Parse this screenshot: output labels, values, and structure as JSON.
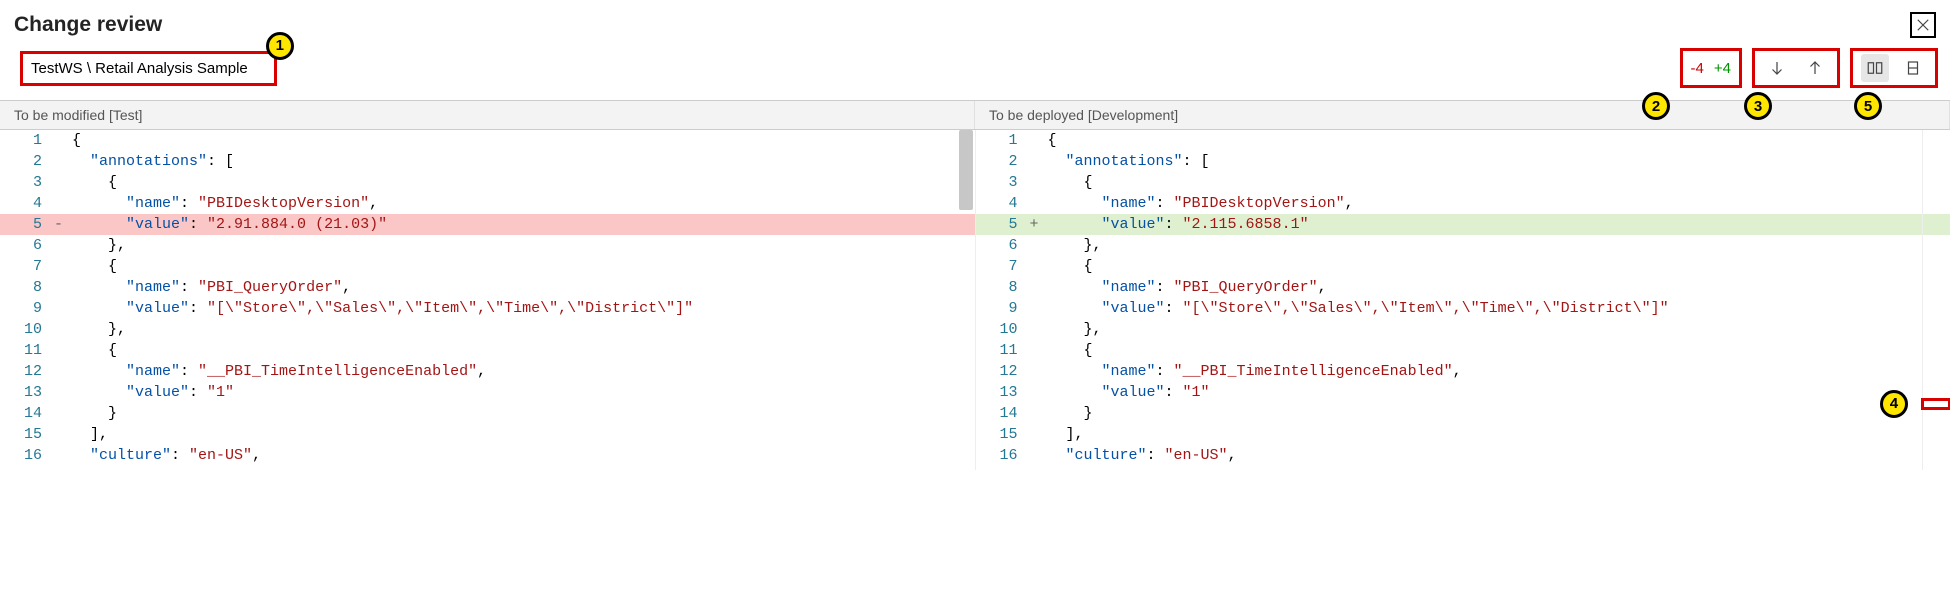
{
  "title": "Change review",
  "breadcrumb": "TestWS \\ Retail Analysis Sample",
  "diffCounts": {
    "removed": "-4",
    "added": "+4"
  },
  "headers": {
    "left": "To be modified [Test]",
    "right": "To be deployed [Development]"
  },
  "callouts": {
    "c1": "1",
    "c2": "2",
    "c3": "3",
    "c4": "4",
    "c5": "5"
  },
  "icons": {
    "close": "close-icon",
    "navDown": "arrow-down-icon",
    "navUp": "arrow-up-icon",
    "sidebyside": "side-by-side-view-icon",
    "inline": "inline-view-icon"
  },
  "code": {
    "left": [
      {
        "n": "1",
        "m": "",
        "tokens": [
          [
            "brace",
            "{"
          ]
        ]
      },
      {
        "n": "2",
        "m": "",
        "tokens": [
          [
            "sp",
            "  "
          ],
          [
            "key",
            "\"annotations\""
          ],
          [
            "punc",
            ": ["
          ]
        ]
      },
      {
        "n": "3",
        "m": "",
        "tokens": [
          [
            "sp",
            "    "
          ],
          [
            "brace",
            "{"
          ]
        ]
      },
      {
        "n": "4",
        "m": "",
        "tokens": [
          [
            "sp",
            "      "
          ],
          [
            "key",
            "\"name\""
          ],
          [
            "punc",
            ": "
          ],
          [
            "str",
            "\"PBIDesktopVersion\""
          ],
          [
            "punc",
            ","
          ]
        ]
      },
      {
        "n": "5",
        "m": "-",
        "hl": "del",
        "tokens": [
          [
            "sp",
            "      "
          ],
          [
            "key",
            "\"value\""
          ],
          [
            "punc",
            ": "
          ],
          [
            "str",
            "\"2.91.884.0 (21.03)\""
          ]
        ]
      },
      {
        "n": "6",
        "m": "",
        "tokens": [
          [
            "sp",
            "    "
          ],
          [
            "brace",
            "},"
          ]
        ]
      },
      {
        "n": "7",
        "m": "",
        "tokens": [
          [
            "sp",
            "    "
          ],
          [
            "brace",
            "{"
          ]
        ]
      },
      {
        "n": "8",
        "m": "",
        "tokens": [
          [
            "sp",
            "      "
          ],
          [
            "key",
            "\"name\""
          ],
          [
            "punc",
            ": "
          ],
          [
            "str",
            "\"PBI_QueryOrder\""
          ],
          [
            "punc",
            ","
          ]
        ]
      },
      {
        "n": "9",
        "m": "",
        "tokens": [
          [
            "sp",
            "      "
          ],
          [
            "key",
            "\"value\""
          ],
          [
            "punc",
            ": "
          ],
          [
            "str",
            "\"[\\\"Store\\\",\\\"Sales\\\",\\\"Item\\\",\\\"Time\\\",\\\"District\\\"]\""
          ]
        ]
      },
      {
        "n": "10",
        "m": "",
        "tokens": [
          [
            "sp",
            "    "
          ],
          [
            "brace",
            "},"
          ]
        ]
      },
      {
        "n": "11",
        "m": "",
        "tokens": [
          [
            "sp",
            "    "
          ],
          [
            "brace",
            "{"
          ]
        ]
      },
      {
        "n": "12",
        "m": "",
        "tokens": [
          [
            "sp",
            "      "
          ],
          [
            "key",
            "\"name\""
          ],
          [
            "punc",
            ": "
          ],
          [
            "str",
            "\"__PBI_TimeIntelligenceEnabled\""
          ],
          [
            "punc",
            ","
          ]
        ]
      },
      {
        "n": "13",
        "m": "",
        "tokens": [
          [
            "sp",
            "      "
          ],
          [
            "key",
            "\"value\""
          ],
          [
            "punc",
            ": "
          ],
          [
            "str",
            "\"1\""
          ]
        ]
      },
      {
        "n": "14",
        "m": "",
        "tokens": [
          [
            "sp",
            "    "
          ],
          [
            "brace",
            "}"
          ]
        ]
      },
      {
        "n": "15",
        "m": "",
        "tokens": [
          [
            "sp",
            "  "
          ],
          [
            "punc",
            "],"
          ]
        ]
      },
      {
        "n": "16",
        "m": "",
        "tokens": [
          [
            "sp",
            "  "
          ],
          [
            "key",
            "\"culture\""
          ],
          [
            "punc",
            ": "
          ],
          [
            "str",
            "\"en-US\""
          ],
          [
            "punc",
            ","
          ]
        ]
      }
    ],
    "right": [
      {
        "n": "1",
        "m": "",
        "tokens": [
          [
            "brace",
            "{"
          ]
        ]
      },
      {
        "n": "2",
        "m": "",
        "tokens": [
          [
            "sp",
            "  "
          ],
          [
            "key",
            "\"annotations\""
          ],
          [
            "punc",
            ": ["
          ]
        ]
      },
      {
        "n": "3",
        "m": "",
        "tokens": [
          [
            "sp",
            "    "
          ],
          [
            "brace",
            "{"
          ]
        ]
      },
      {
        "n": "4",
        "m": "",
        "tokens": [
          [
            "sp",
            "      "
          ],
          [
            "key",
            "\"name\""
          ],
          [
            "punc",
            ": "
          ],
          [
            "str",
            "\"PBIDesktopVersion\""
          ],
          [
            "punc",
            ","
          ]
        ]
      },
      {
        "n": "5",
        "m": "+",
        "hl": "add",
        "tokens": [
          [
            "sp",
            "      "
          ],
          [
            "key",
            "\"value\""
          ],
          [
            "punc",
            ": "
          ],
          [
            "str",
            "\"2.115.6858.1\""
          ]
        ]
      },
      {
        "n": "6",
        "m": "",
        "tokens": [
          [
            "sp",
            "    "
          ],
          [
            "brace",
            "},"
          ]
        ]
      },
      {
        "n": "7",
        "m": "",
        "tokens": [
          [
            "sp",
            "    "
          ],
          [
            "brace",
            "{"
          ]
        ]
      },
      {
        "n": "8",
        "m": "",
        "tokens": [
          [
            "sp",
            "      "
          ],
          [
            "key",
            "\"name\""
          ],
          [
            "punc",
            ": "
          ],
          [
            "str",
            "\"PBI_QueryOrder\""
          ],
          [
            "punc",
            ","
          ]
        ]
      },
      {
        "n": "9",
        "m": "",
        "tokens": [
          [
            "sp",
            "      "
          ],
          [
            "key",
            "\"value\""
          ],
          [
            "punc",
            ": "
          ],
          [
            "str",
            "\"[\\\"Store\\\",\\\"Sales\\\",\\\"Item\\\",\\\"Time\\\",\\\"District\\\"]\""
          ]
        ]
      },
      {
        "n": "10",
        "m": "",
        "tokens": [
          [
            "sp",
            "    "
          ],
          [
            "brace",
            "},"
          ]
        ]
      },
      {
        "n": "11",
        "m": "",
        "tokens": [
          [
            "sp",
            "    "
          ],
          [
            "brace",
            "{"
          ]
        ]
      },
      {
        "n": "12",
        "m": "",
        "tokens": [
          [
            "sp",
            "      "
          ],
          [
            "key",
            "\"name\""
          ],
          [
            "punc",
            ": "
          ],
          [
            "str",
            "\"__PBI_TimeIntelligenceEnabled\""
          ],
          [
            "punc",
            ","
          ]
        ]
      },
      {
        "n": "13",
        "m": "",
        "tokens": [
          [
            "sp",
            "      "
          ],
          [
            "key",
            "\"value\""
          ],
          [
            "punc",
            ": "
          ],
          [
            "str",
            "\"1\""
          ]
        ]
      },
      {
        "n": "14",
        "m": "",
        "tokens": [
          [
            "sp",
            "    "
          ],
          [
            "brace",
            "}"
          ]
        ]
      },
      {
        "n": "15",
        "m": "",
        "tokens": [
          [
            "sp",
            "  "
          ],
          [
            "punc",
            "],"
          ]
        ]
      },
      {
        "n": "16",
        "m": "",
        "tokens": [
          [
            "sp",
            "  "
          ],
          [
            "key",
            "\"culture\""
          ],
          [
            "punc",
            ": "
          ],
          [
            "str",
            "\"en-US\""
          ],
          [
            "punc",
            ","
          ]
        ]
      }
    ]
  }
}
